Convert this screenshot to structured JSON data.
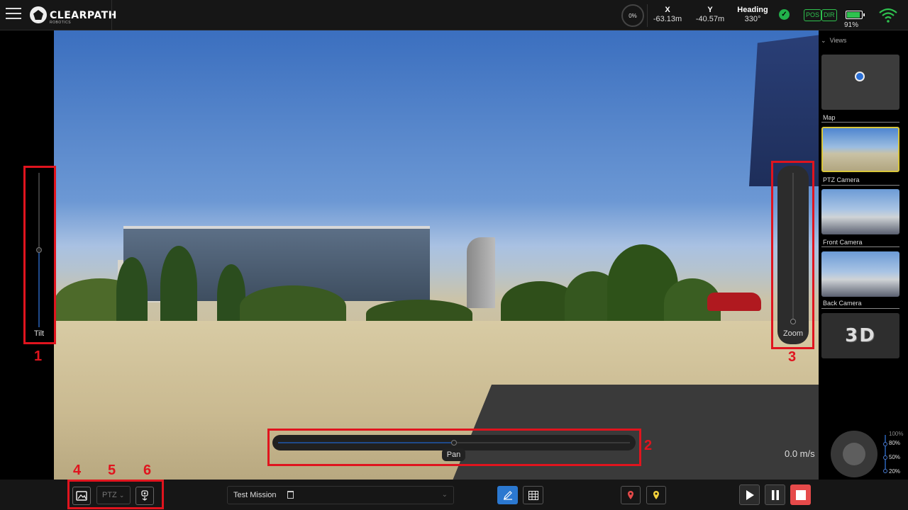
{
  "header": {
    "brand": "CLEARPATH",
    "brand_sub": "ROBOTICS",
    "progress": "0%",
    "x_label": "X",
    "x_value": "-63.13m",
    "y_label": "Y",
    "y_value": "-40.57m",
    "heading_label": "Heading",
    "heading_value": "330°",
    "status_icon": "check-icon",
    "pos_badge": "POS",
    "dir_badge": "DIR",
    "battery_level": 0.91,
    "battery_label": "91%",
    "wifi_icon": "wifi-icon"
  },
  "sliders": {
    "tilt_label": "Tilt",
    "tilt_level": 0.5,
    "zoom_label": "Zoom",
    "zoom_level": 0.02,
    "pan_label": "Pan",
    "pan_level": 0.5
  },
  "annotations": {
    "a1": "1",
    "a2": "2",
    "a3": "3",
    "a4": "4",
    "a5": "5",
    "a6": "6",
    "color": "#e0141e"
  },
  "views": {
    "heading": "Views",
    "items": [
      {
        "label": "Map"
      },
      {
        "label": "PTZ Camera",
        "selected": true
      },
      {
        "label": "Front Camera"
      },
      {
        "label": "Back Camera"
      },
      {
        "label": "3D"
      }
    ]
  },
  "drive": {
    "speed": "0.0 m/s",
    "scale": [
      "100%",
      "80%",
      "50%",
      "20%"
    ]
  },
  "toolbar": {
    "ptz_select": "PTZ",
    "mission_select": "Test Mission",
    "accent": "#2b78d0",
    "stop_color": "#e64a4a"
  }
}
